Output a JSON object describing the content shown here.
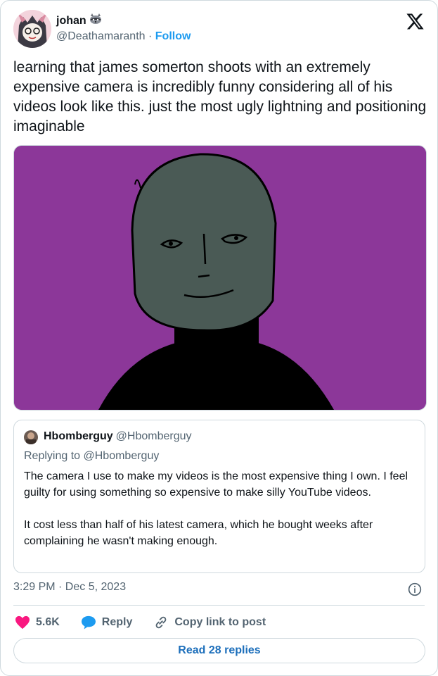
{
  "author": {
    "name": "johan",
    "name_emoji": "raccoon-emoji",
    "handle": "@Deathamaranth",
    "separator": "·",
    "follow_label": "Follow"
  },
  "tweet": {
    "text": "learning that james somerton shoots with an extremely expensive camera is incredibly funny considering all of his videos look like this. just the most ugly lightning and positioning imaginable",
    "timestamp": "3:29 PM · Dec 5, 2023"
  },
  "quote": {
    "name": "Hbomberguy",
    "handle": "@Hbomberguy",
    "replying_to": "Replying to @Hbomberguy",
    "text": "The camera I use to make my videos is the most expensive thing I own. I feel guilty for using something so expensive to make silly YouTube videos.\n\nIt cost less than half of his latest camera, which he bought weeks after complaining he wasn't making enough."
  },
  "actions": {
    "like_count": "5.6K",
    "reply_label": "Reply",
    "copy_label": "Copy link to post"
  },
  "read_replies_label": "Read 28 replies",
  "colors": {
    "accent": "#1d9bf0",
    "like": "#f91880",
    "media_bg": "#8c3799"
  }
}
